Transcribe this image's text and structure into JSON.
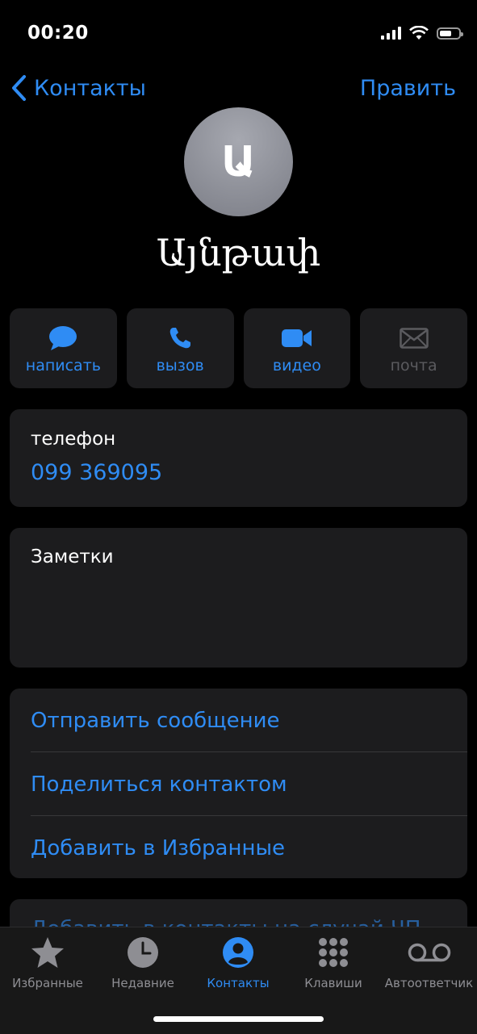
{
  "status_bar": {
    "time": "00:20"
  },
  "nav": {
    "back_label": "Контакты",
    "edit_label": "Править"
  },
  "contact": {
    "initial": "Ա",
    "name": "Այնթափ"
  },
  "actions": [
    {
      "label": "написать",
      "icon": "message-icon",
      "enabled": true
    },
    {
      "label": "вызов",
      "icon": "phone-icon",
      "enabled": true
    },
    {
      "label": "видео",
      "icon": "video-icon",
      "enabled": true
    },
    {
      "label": "почта",
      "icon": "mail-icon",
      "enabled": false
    }
  ],
  "phone_card": {
    "label": "телефон",
    "number": "099 369095"
  },
  "notes_card": {
    "label": "Заметки"
  },
  "links": [
    "Отправить сообщение",
    "Поделиться контактом",
    "Добавить в Избранные"
  ],
  "next_card_peek": "Добавить в контакты на случай ЧП",
  "tabbar": {
    "items": [
      {
        "label": "Избранные",
        "icon": "star-icon"
      },
      {
        "label": "Недавние",
        "icon": "clock-icon"
      },
      {
        "label": "Контакты",
        "icon": "person-circle-icon",
        "active": true
      },
      {
        "label": "Клавиши",
        "icon": "keypad-icon"
      },
      {
        "label": "Автоответчик",
        "icon": "voicemail-icon"
      }
    ]
  },
  "colors": {
    "accent": "#2f8cf4",
    "card": "#1c1c1e",
    "background": "#000000"
  }
}
